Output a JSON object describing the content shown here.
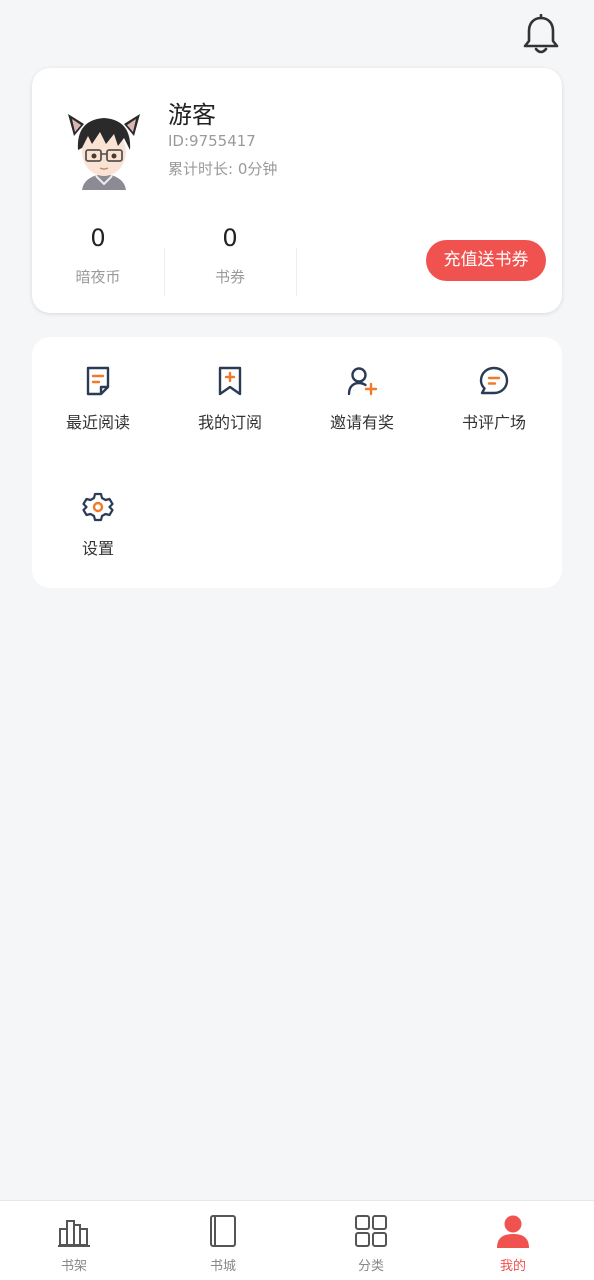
{
  "header": {
    "bell_icon": "bell-icon"
  },
  "profile": {
    "name": "游客",
    "id": "ID:9755417",
    "time": "累计时长: 0分钟",
    "stats": [
      {
        "value": "0",
        "label": "暗夜币"
      },
      {
        "value": "0",
        "label": "书券"
      }
    ],
    "recharge_label": "充值送书券"
  },
  "menu": {
    "items": [
      {
        "label": "最近阅读",
        "icon": "recent-read-icon"
      },
      {
        "label": "我的订阅",
        "icon": "bookmark-plus-icon"
      },
      {
        "label": "邀请有奖",
        "icon": "user-plus-icon"
      },
      {
        "label": "书评广场",
        "icon": "chat-icon"
      },
      {
        "label": "设置",
        "icon": "gear-icon"
      }
    ]
  },
  "tabbar": {
    "tabs": [
      {
        "label": "书架",
        "icon": "bookshelf-icon"
      },
      {
        "label": "书城",
        "icon": "book-icon"
      },
      {
        "label": "分类",
        "icon": "grid-icon"
      },
      {
        "label": "我的",
        "icon": "person-icon",
        "active": true
      }
    ]
  },
  "colors": {
    "accent": "#f0524f",
    "icon_orange": "#f07a2a",
    "icon_dark": "#2b3a55"
  }
}
